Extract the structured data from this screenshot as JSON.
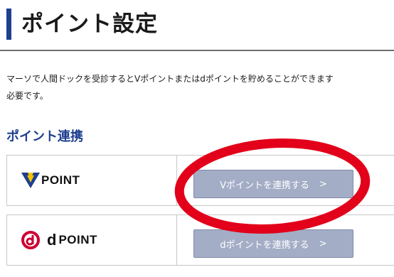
{
  "page": {
    "title": "ポイント設定",
    "description_line1": "マーソで人間ドックを受診するとVポイントまたはdポイントを貯めることができます",
    "description_line2": "必要です。"
  },
  "section": {
    "title": "ポイント連携"
  },
  "partners": [
    {
      "logo_text": "POINT",
      "logo_icon": "v-point-logo",
      "button_label": "Vポイントを連携する",
      "button_chevron": ">"
    },
    {
      "logo_letter": "d",
      "logo_text": "POINT",
      "logo_icon": "d-point-logo",
      "button_label": "dポイントを連携する",
      "button_chevron": ">"
    }
  ],
  "colors": {
    "accent": "#1f3f8f",
    "button_bg": "#a3adc6",
    "highlight_circle": "#e2001a",
    "v_point_blue": "#1d3f93",
    "v_point_yellow": "#f5c400",
    "d_point_red": "#cc0033"
  }
}
